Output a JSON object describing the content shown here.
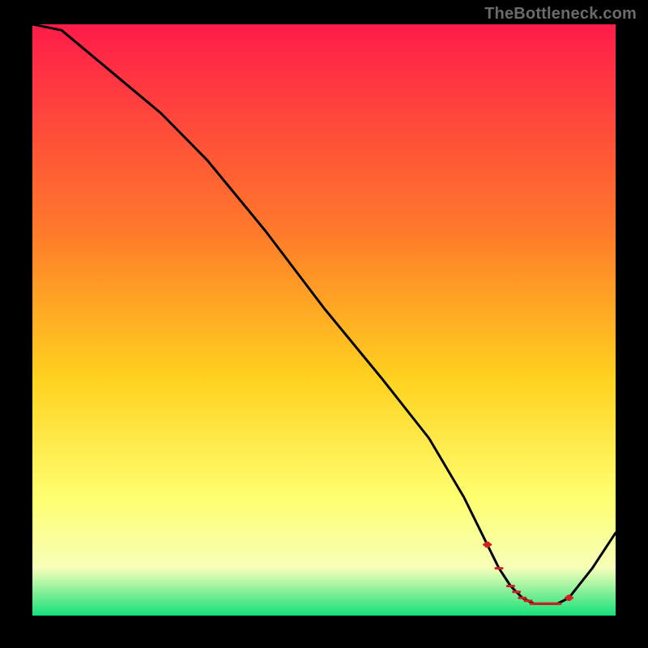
{
  "watermark": "TheBottleneck.com",
  "colors": {
    "grad_top": "#ff1c4a",
    "grad_mid1": "#ff7a2a",
    "grad_mid2": "#ffd21f",
    "grad_mid3": "#ffff70",
    "grad_mid4": "#f6ffb8",
    "grad_bottom": "#15e07a",
    "line": "#000000",
    "marker": "#d02020"
  },
  "chart_data": {
    "type": "line",
    "title": "",
    "xlabel": "",
    "ylabel": "",
    "xlim": [
      0,
      100
    ],
    "ylim": [
      0,
      100
    ],
    "x": [
      0,
      5,
      22,
      30,
      40,
      50,
      60,
      68,
      74,
      78,
      80,
      82,
      84,
      86,
      88,
      90,
      92,
      96,
      100
    ],
    "values": [
      104,
      99,
      85,
      77,
      65,
      52,
      40,
      30,
      20,
      12,
      8,
      5,
      3,
      2,
      2,
      2,
      3,
      8,
      14
    ],
    "markers_x": [
      78,
      80,
      82,
      83,
      84,
      85,
      86,
      87,
      88,
      89,
      90,
      92
    ]
  }
}
